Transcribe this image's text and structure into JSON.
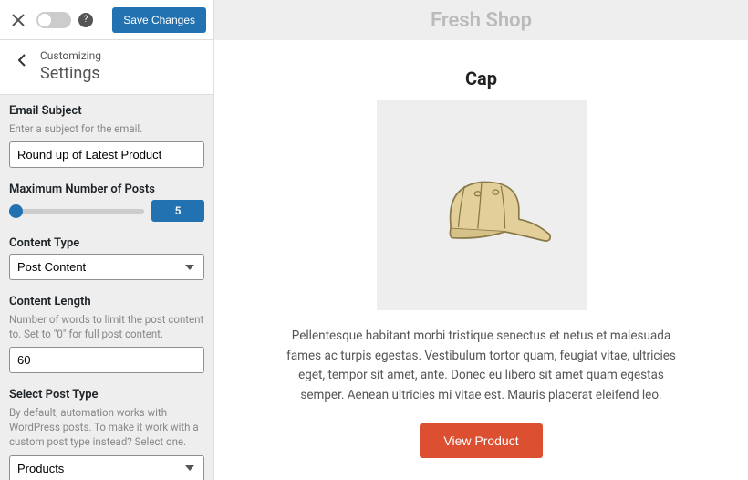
{
  "topbar": {
    "save_label": "Save Changes",
    "help_symbol": "?"
  },
  "header": {
    "over": "Customizing",
    "title": "Settings"
  },
  "fields": {
    "email_subject": {
      "label": "Email Subject",
      "hint": "Enter a subject for the email.",
      "value": "Round up of Latest Product"
    },
    "max_posts": {
      "label": "Maximum Number of Posts",
      "value": "5"
    },
    "content_type": {
      "label": "Content Type",
      "value": "Post Content"
    },
    "content_length": {
      "label": "Content Length",
      "hint": "Number of words to limit the post content to. Set to \"0\" for full post content.",
      "value": "60"
    },
    "post_type": {
      "label": "Select Post Type",
      "hint": "By default, automation works with WordPress posts. To make it work with a custom post type instead? Select one.",
      "value": "Products"
    }
  },
  "preview": {
    "brand": "Fresh Shop",
    "product_title": "Cap",
    "description": "Pellentesque habitant morbi tristique senectus et netus et malesuada fames ac turpis egestas. Vestibulum tortor quam, feugiat vitae, ultricies eget, tempor sit amet, ante. Donec eu libero sit amet quam egestas semper. Aenean ultricies mi vitae est. Mauris placerat eleifend leo.",
    "view_label": "View Product"
  }
}
